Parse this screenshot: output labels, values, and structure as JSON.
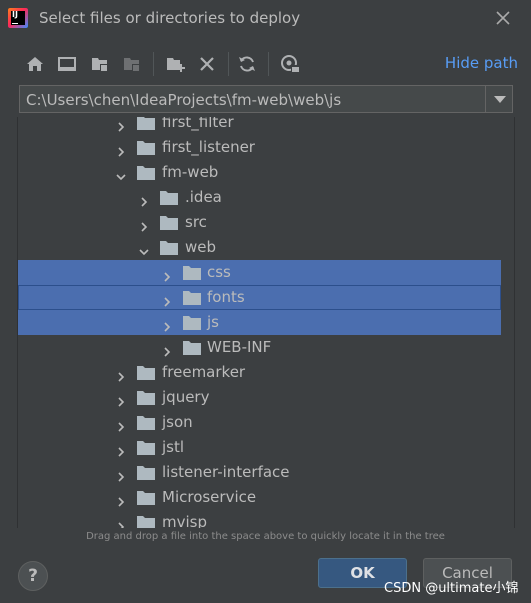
{
  "window": {
    "title": "Select files or directories to deploy",
    "app_icon_text": "IJ"
  },
  "toolbar": {
    "hide_path_label": "Hide path",
    "icons": [
      "home-icon",
      "desktop-icon",
      "project-folder-icon",
      "module-folder-icon",
      "new-folder-icon",
      "delete-icon",
      "refresh-icon",
      "show-hidden-icon"
    ]
  },
  "path": {
    "value": "C:\\Users\\chen\\IdeaProjects\\fm-web\\web\\js"
  },
  "tree": {
    "items": [
      {
        "label": "first_filter",
        "expanded": false,
        "depth": 0
      },
      {
        "label": "first_listener",
        "expanded": false,
        "depth": 0
      },
      {
        "label": "fm-web",
        "expanded": true,
        "depth": 0
      },
      {
        "label": ".idea",
        "expanded": false,
        "depth": 1
      },
      {
        "label": "src",
        "expanded": false,
        "depth": 1
      },
      {
        "label": "web",
        "expanded": true,
        "depth": 1
      },
      {
        "label": "css",
        "expanded": false,
        "depth": 2,
        "selected": true
      },
      {
        "label": "fonts",
        "expanded": false,
        "depth": 2,
        "selected": true
      },
      {
        "label": "js",
        "expanded": false,
        "depth": 2,
        "selected": true
      },
      {
        "label": "WEB-INF",
        "expanded": false,
        "depth": 2
      },
      {
        "label": "freemarker",
        "expanded": false,
        "depth": 0
      },
      {
        "label": "jquery",
        "expanded": false,
        "depth": 0
      },
      {
        "label": "json",
        "expanded": false,
        "depth": 0
      },
      {
        "label": "jstl",
        "expanded": false,
        "depth": 0
      },
      {
        "label": "listener-interface",
        "expanded": false,
        "depth": 0
      },
      {
        "label": "Microservice",
        "expanded": false,
        "depth": 0
      },
      {
        "label": "mvisp",
        "expanded": false,
        "depth": 0
      }
    ]
  },
  "hint": "Drag and drop a file into the space above to quickly locate it in the tree",
  "buttons": {
    "help": "?",
    "ok": "OK",
    "cancel": "Cancel"
  },
  "watermark": "CSDN @ultimate小锦",
  "colors": {
    "background": "#3c3f41",
    "selection": "#4b6eaf",
    "link": "#589df6",
    "ok_button": "#365880",
    "folder": "#aeb9c0"
  }
}
